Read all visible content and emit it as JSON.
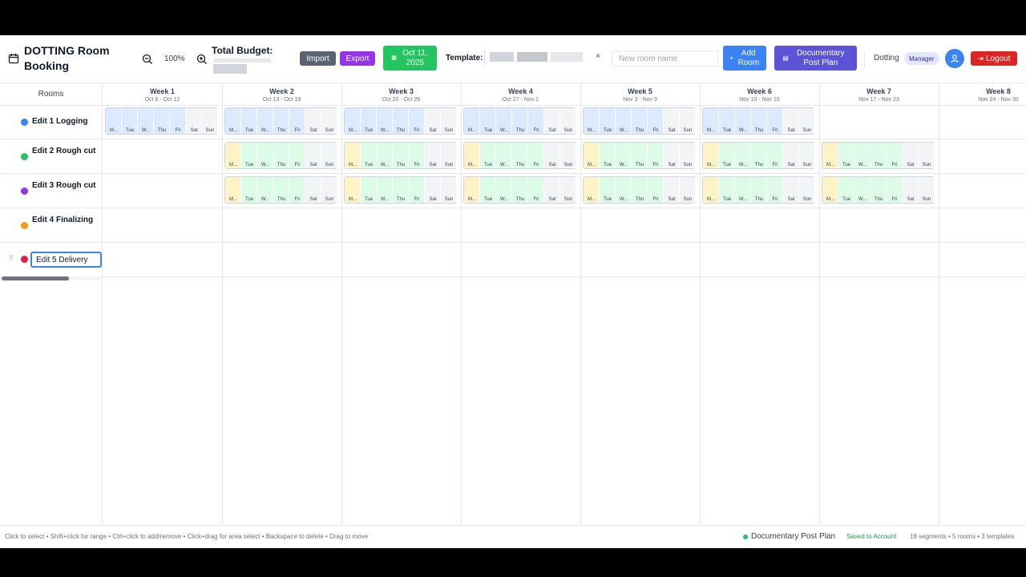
{
  "header": {
    "title": "DOTTING Room Booking",
    "zoom_level": "100%",
    "budget_label": "Total Budget:",
    "import_label": "Import",
    "export_label": "Export",
    "date_label": "Oct 11, 2025",
    "template_label": "Template:",
    "template_clear": "×",
    "room_input_placeholder": "New room name",
    "add_room_label": "Add Room",
    "template_button_label": "Documentary Post Plan",
    "user_name": "Dotting",
    "role": "Manager",
    "logout_label": "Logout"
  },
  "rooms_header": "Rooms",
  "rooms": [
    {
      "name": "Edit 1 Logging",
      "color": "#3b82f6"
    },
    {
      "name": "Edit 2 Rough cut",
      "color": "#22c55e"
    },
    {
      "name": "Edit 3 Rough cut",
      "color": "#9333ea"
    },
    {
      "name": "Edit 4 Finalizing",
      "color": "#f59e0b"
    },
    {
      "name": "Edit 5 Delivery",
      "color": "#e11d48",
      "editing": true
    }
  ],
  "weeks": [
    {
      "name": "Week 1",
      "range": "Oct 6 - Oct 12"
    },
    {
      "name": "Week 2",
      "range": "Oct 13 - Oct 19"
    },
    {
      "name": "Week 3",
      "range": "Oct 20 - Oct 26"
    },
    {
      "name": "Week 4",
      "range": "Oct 27 - Nov 2"
    },
    {
      "name": "Week 5",
      "range": "Nov 3 - Nov 9"
    },
    {
      "name": "Week 6",
      "range": "Nov 10 - Nov 16"
    },
    {
      "name": "Week 7",
      "range": "Nov 17 - Nov 23"
    },
    {
      "name": "Week 8",
      "range": "Nov 24 - Nov 30"
    }
  ],
  "day_labels": [
    "M...",
    "Tue",
    "W...",
    "Thu",
    "Fri",
    "Sat",
    "Sun"
  ],
  "segments": [
    {
      "room": 0,
      "week": 0,
      "pattern": "blue"
    },
    {
      "room": 0,
      "week": 1,
      "pattern": "blue"
    },
    {
      "room": 0,
      "week": 2,
      "pattern": "blue"
    },
    {
      "room": 0,
      "week": 3,
      "pattern": "blue"
    },
    {
      "room": 0,
      "week": 4,
      "pattern": "blue"
    },
    {
      "room": 0,
      "week": 5,
      "pattern": "blue"
    },
    {
      "room": 1,
      "week": 1,
      "pattern": "yellow-green"
    },
    {
      "room": 1,
      "week": 2,
      "pattern": "yellow-green"
    },
    {
      "room": 1,
      "week": 3,
      "pattern": "yellow-green"
    },
    {
      "room": 1,
      "week": 4,
      "pattern": "yellow-green"
    },
    {
      "room": 1,
      "week": 5,
      "pattern": "yellow-green"
    },
    {
      "room": 1,
      "week": 6,
      "pattern": "yellow-green"
    },
    {
      "room": 2,
      "week": 1,
      "pattern": "yellow-green"
    },
    {
      "room": 2,
      "week": 2,
      "pattern": "yellow-green"
    },
    {
      "room": 2,
      "week": 3,
      "pattern": "yellow-green"
    },
    {
      "room": 2,
      "week": 4,
      "pattern": "yellow-green"
    },
    {
      "room": 2,
      "week": 5,
      "pattern": "yellow-green"
    },
    {
      "room": 2,
      "week": 6,
      "pattern": "yellow-green"
    }
  ],
  "colors": {
    "blue_day": "#dbeafe",
    "green_day": "#dcfce7",
    "yellow_day": "#fef3c7",
    "weekend_day": "#f3f4f6"
  },
  "footer": {
    "hint": "Click to select • Shift+click for range • Ctrl+click to add/remove • Click+drag for area select • Backspace to delete • Drag to move",
    "plan_name": "Documentary Post Plan",
    "saved": "Saved to Account",
    "stats": "18 segments • 5 rooms • 3 templates"
  }
}
